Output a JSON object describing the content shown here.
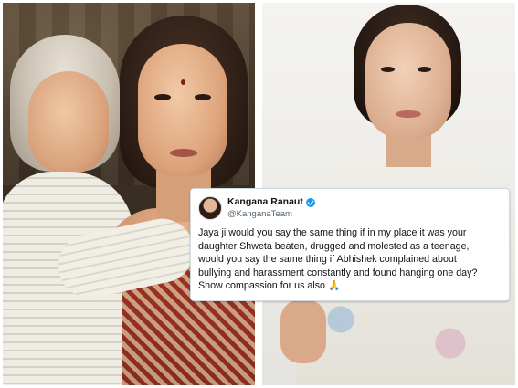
{
  "tweet": {
    "name": "Kangana Ranaut",
    "handle": "@KanganaTeam",
    "lines": [
      "Jaya ji would you say the same thing if in my place it was your",
      "daughter Shweta beaten, drugged and molested as a teenage,",
      "would you say the same thing if Abhishek complained about",
      "bullying and harassment constantly and found hanging one day?",
      "Show compassion for us also"
    ],
    "emoji": "🙏",
    "verified_icon": "verified-badge-icon"
  },
  "colors": {
    "verified": "#1d9bf0",
    "tweet_border": "#cfd9de"
  }
}
